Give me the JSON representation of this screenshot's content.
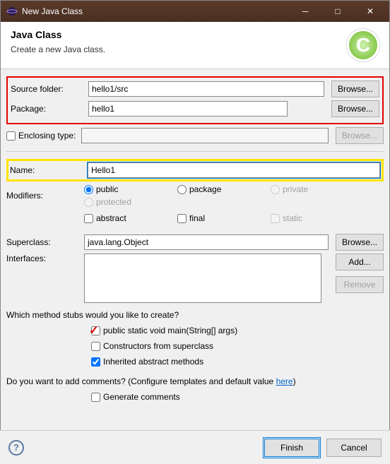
{
  "window": {
    "title": "New Java Class"
  },
  "header": {
    "title": "Java Class",
    "subtitle": "Create a new Java class."
  },
  "labels": {
    "sourceFolder": "Source folder:",
    "package": "Package:",
    "enclosing": "Enclosing type:",
    "name": "Name:",
    "modifiers": "Modifiers:",
    "superclass": "Superclass:",
    "interfaces": "Interfaces:"
  },
  "values": {
    "sourceFolder": "hello1/src",
    "package": "hello1",
    "enclosing": "",
    "name": "Hello1",
    "superclass": "java.lang.Object"
  },
  "modifiers": {
    "public": "public",
    "package": "package",
    "private": "private",
    "protected": "protected",
    "abstract": "abstract",
    "final": "final",
    "static": "static"
  },
  "buttons": {
    "browse": "Browse...",
    "add": "Add...",
    "remove": "Remove",
    "finish": "Finish",
    "cancel": "Cancel"
  },
  "stubs": {
    "question": "Which method stubs would you like to create?",
    "main": "public static void main(String[] args)",
    "constructors": "Constructors from superclass",
    "inherited": "Inherited abstract methods"
  },
  "comments": {
    "prefix": "Do you want to add comments? (Configure templates and default value ",
    "link": "here",
    "suffix": ")",
    "generate": "Generate comments"
  }
}
